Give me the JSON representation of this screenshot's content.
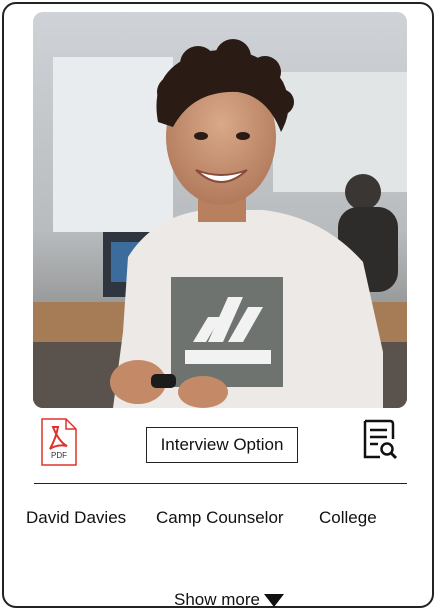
{
  "photo": {
    "alt_icon": "profile-photo"
  },
  "actions": {
    "pdf_icon": "pdf-file-icon",
    "pdf_label": "PDF",
    "interview_label": "Interview Option",
    "search_icon": "document-search-icon"
  },
  "profile": {
    "name": "David Davies",
    "role": "Camp Counselor",
    "level": "College"
  },
  "footer": {
    "show_more_label": "Show more"
  },
  "colors": {
    "pdf_red": "#e0322b",
    "border": "#222222"
  }
}
